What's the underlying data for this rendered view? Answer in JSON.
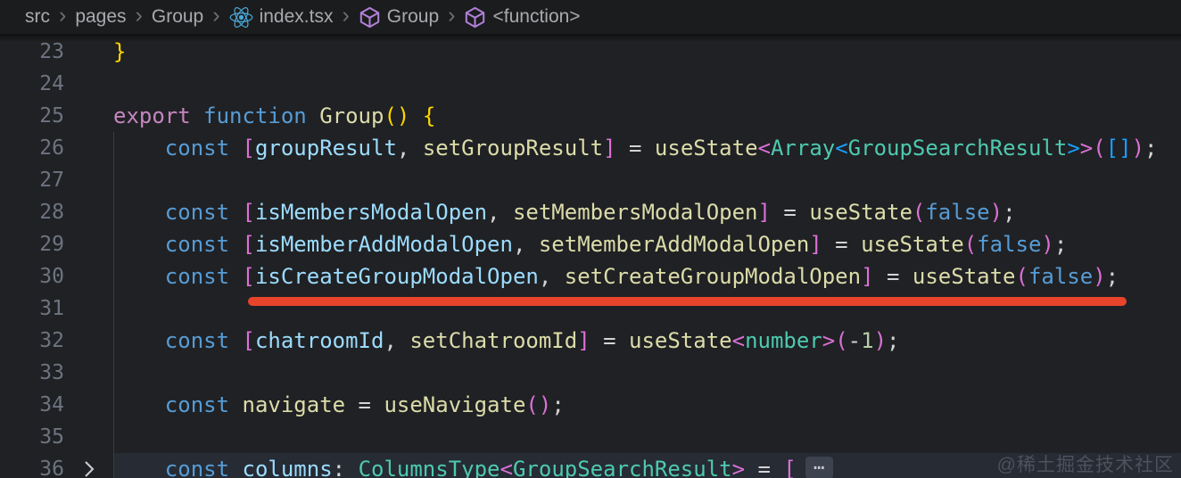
{
  "breadcrumb": {
    "separator": "›",
    "items": [
      {
        "label": "src"
      },
      {
        "label": "pages"
      },
      {
        "label": "Group"
      },
      {
        "label": "index.tsx",
        "icon": "react-icon"
      },
      {
        "label": "Group",
        "icon": "symbol-cube-icon"
      },
      {
        "label": "<function>",
        "icon": "symbol-cube-icon"
      }
    ]
  },
  "editor": {
    "fold_badge": "⋯",
    "lines": [
      {
        "num": "23",
        "tokens": [
          {
            "t": "}",
            "c": "b1"
          }
        ]
      },
      {
        "num": "24",
        "tokens": []
      },
      {
        "num": "25",
        "tokens": [
          {
            "t": "export ",
            "c": "ctrl"
          },
          {
            "t": "function ",
            "c": "kw"
          },
          {
            "t": "Group",
            "c": "fn"
          },
          {
            "t": "()",
            "c": "b1"
          },
          {
            "t": " ",
            "c": "pun"
          },
          {
            "t": "{",
            "c": "b1"
          }
        ]
      },
      {
        "num": "26",
        "tokens": [
          {
            "t": "    const ",
            "c": "kw"
          },
          {
            "t": "[",
            "c": "b2"
          },
          {
            "t": "groupResult",
            "c": "var"
          },
          {
            "t": ", ",
            "c": "pun"
          },
          {
            "t": "setGroupResult",
            "c": "fn"
          },
          {
            "t": "]",
            "c": "b2"
          },
          {
            "t": " = ",
            "c": "pun"
          },
          {
            "t": "useState",
            "c": "fn"
          },
          {
            "t": "<",
            "c": "b2"
          },
          {
            "t": "Array",
            "c": "type"
          },
          {
            "t": "<",
            "c": "b3"
          },
          {
            "t": "GroupSearchResult",
            "c": "type"
          },
          {
            "t": ">",
            "c": "b3"
          },
          {
            "t": ">",
            "c": "b2"
          },
          {
            "t": "(",
            "c": "b2"
          },
          {
            "t": "[]",
            "c": "b3"
          },
          {
            "t": ")",
            "c": "b2"
          },
          {
            "t": ";",
            "c": "pun"
          }
        ]
      },
      {
        "num": "27",
        "tokens": []
      },
      {
        "num": "28",
        "tokens": [
          {
            "t": "    const ",
            "c": "kw"
          },
          {
            "t": "[",
            "c": "b2"
          },
          {
            "t": "isMembersModalOpen",
            "c": "var"
          },
          {
            "t": ", ",
            "c": "pun"
          },
          {
            "t": "setMembersModalOpen",
            "c": "fn"
          },
          {
            "t": "]",
            "c": "b2"
          },
          {
            "t": " = ",
            "c": "pun"
          },
          {
            "t": "useState",
            "c": "fn"
          },
          {
            "t": "(",
            "c": "b2"
          },
          {
            "t": "false",
            "c": "kw"
          },
          {
            "t": ")",
            "c": "b2"
          },
          {
            "t": ";",
            "c": "pun"
          }
        ]
      },
      {
        "num": "29",
        "tokens": [
          {
            "t": "    const ",
            "c": "kw"
          },
          {
            "t": "[",
            "c": "b2"
          },
          {
            "t": "isMemberAddModalOpen",
            "c": "var"
          },
          {
            "t": ", ",
            "c": "pun"
          },
          {
            "t": "setMemberAddModalOpen",
            "c": "fn"
          },
          {
            "t": "]",
            "c": "b2"
          },
          {
            "t": " = ",
            "c": "pun"
          },
          {
            "t": "useState",
            "c": "fn"
          },
          {
            "t": "(",
            "c": "b2"
          },
          {
            "t": "false",
            "c": "kw"
          },
          {
            "t": ")",
            "c": "b2"
          },
          {
            "t": ";",
            "c": "pun"
          }
        ]
      },
      {
        "num": "30",
        "tokens": [
          {
            "t": "    const ",
            "c": "kw"
          },
          {
            "t": "[",
            "c": "b2"
          },
          {
            "t": "isCreateGroupModalOpen",
            "c": "var"
          },
          {
            "t": ", ",
            "c": "pun"
          },
          {
            "t": "setCreateGroupModalOpen",
            "c": "fn"
          },
          {
            "t": "]",
            "c": "b2"
          },
          {
            "t": " = ",
            "c": "pun"
          },
          {
            "t": "useState",
            "c": "fn"
          },
          {
            "t": "(",
            "c": "b2"
          },
          {
            "t": "false",
            "c": "kw"
          },
          {
            "t": ")",
            "c": "b2"
          },
          {
            "t": ";",
            "c": "pun"
          }
        ]
      },
      {
        "num": "31",
        "tokens": []
      },
      {
        "num": "32",
        "tokens": [
          {
            "t": "    const ",
            "c": "kw"
          },
          {
            "t": "[",
            "c": "b2"
          },
          {
            "t": "chatroomId",
            "c": "var"
          },
          {
            "t": ", ",
            "c": "pun"
          },
          {
            "t": "setChatroomId",
            "c": "fn"
          },
          {
            "t": "]",
            "c": "b2"
          },
          {
            "t": " = ",
            "c": "pun"
          },
          {
            "t": "useState",
            "c": "fn"
          },
          {
            "t": "<",
            "c": "b2"
          },
          {
            "t": "number",
            "c": "type"
          },
          {
            "t": ">",
            "c": "b2"
          },
          {
            "t": "(",
            "c": "b2"
          },
          {
            "t": "-",
            "c": "pun"
          },
          {
            "t": "1",
            "c": "num"
          },
          {
            "t": ")",
            "c": "b2"
          },
          {
            "t": ";",
            "c": "pun"
          }
        ]
      },
      {
        "num": "33",
        "tokens": []
      },
      {
        "num": "34",
        "tokens": [
          {
            "t": "    const ",
            "c": "kw"
          },
          {
            "t": "navigate",
            "c": "fn"
          },
          {
            "t": " = ",
            "c": "pun"
          },
          {
            "t": "useNavigate",
            "c": "fn"
          },
          {
            "t": "()",
            "c": "b2"
          },
          {
            "t": ";",
            "c": "pun"
          }
        ]
      },
      {
        "num": "35",
        "tokens": []
      },
      {
        "num": "36",
        "highlighted": true,
        "folded": true,
        "fold_chevron": true,
        "tokens": [
          {
            "t": "    const ",
            "c": "kw"
          },
          {
            "t": "columns",
            "c": "var"
          },
          {
            "t": ": ",
            "c": "pun"
          },
          {
            "t": "ColumnsType",
            "c": "type"
          },
          {
            "t": "<",
            "c": "b2"
          },
          {
            "t": "GroupSearchResult",
            "c": "type"
          },
          {
            "t": ">",
            "c": "b2"
          },
          {
            "t": " = ",
            "c": "pun"
          },
          {
            "t": "[",
            "c": "b2"
          }
        ]
      }
    ]
  },
  "watermark": {
    "text": "@稀土掘金技术社区"
  },
  "colors": {
    "editor_bg": "#202124",
    "breadcrumb_bg": "#1b1c1e",
    "breadcrumb_fg": "#a8aaad",
    "highlight_row_bg": "#262b34",
    "gutter_fg": "#6d7480",
    "indent_guide": "#3a3d43",
    "watermark_fg": "#4c525e",
    "error": "#e8442c",
    "react_icon": "#4aa8d8",
    "cube_icon": "#b180d7",
    "ctrl": "#c586c0",
    "kw": "#569cd6",
    "fn": "#dcdcaa",
    "var": "#9cdcfe",
    "type": "#4ec9b0",
    "num": "#b5cea8",
    "pun": "#d4d4d4",
    "b1": "#ffd700",
    "b2": "#da70d6",
    "b3": "#179fff"
  }
}
